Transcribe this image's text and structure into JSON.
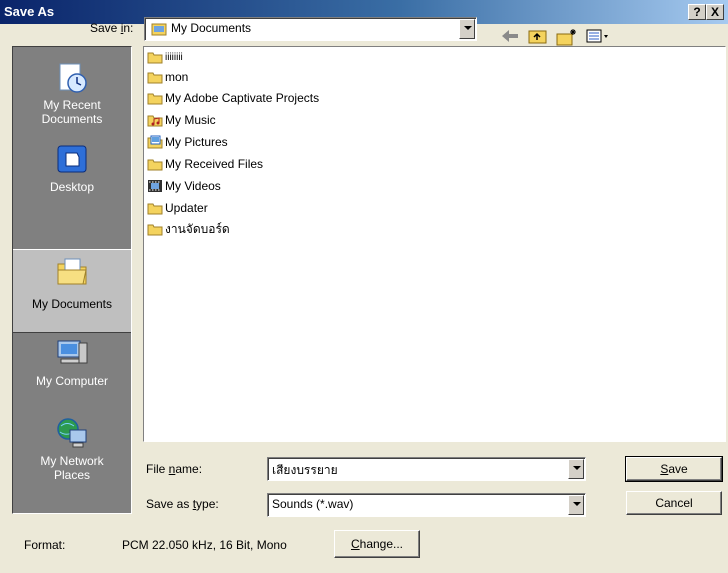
{
  "window": {
    "title": "Save As",
    "help_label": "?",
    "close_label": "X"
  },
  "toolbar": {
    "save_in_label": "Save in:",
    "save_in_value": "My Documents",
    "icons": [
      "back-arrow-icon",
      "up-folder-icon",
      "new-folder-icon",
      "view-menu-icon"
    ]
  },
  "places": [
    {
      "label": "My Recent\nDocuments",
      "icon": "recent-documents-icon"
    },
    {
      "label": "Desktop",
      "icon": "desktop-icon"
    },
    {
      "label": "My Documents",
      "icon": "my-documents-icon"
    },
    {
      "label": "My Computer",
      "icon": "my-computer-icon"
    },
    {
      "label": "My Network\nPlaces",
      "icon": "network-places-icon"
    }
  ],
  "files": [
    {
      "name": "iiiiiiii",
      "icon": "folder"
    },
    {
      "name": "mon",
      "icon": "folder"
    },
    {
      "name": "My Adobe Captivate Projects",
      "icon": "folder"
    },
    {
      "name": "My Music",
      "icon": "music-folder"
    },
    {
      "name": "My Pictures",
      "icon": "pictures-folder"
    },
    {
      "name": "My Received Files",
      "icon": "folder"
    },
    {
      "name": "My Videos",
      "icon": "videos-folder"
    },
    {
      "name": "Updater",
      "icon": "folder"
    },
    {
      "name": "งานจัดบอร์ด",
      "icon": "folder"
    }
  ],
  "form": {
    "file_name_label": "File name:",
    "file_name_value": "เสียงบรรยาย",
    "save_type_label": "Save as type:",
    "save_type_value": "Sounds (*.wav)",
    "save_button": "Save",
    "cancel_button": "Cancel"
  },
  "format": {
    "label": "Format:",
    "value": "PCM 22.050 kHz, 16 Bit, Mono",
    "change_button": "Change..."
  },
  "colors": {
    "titlebar": "#0A246A",
    "dialog_bg": "#ECE9D8",
    "places_bg": "#808080",
    "folder": "#F4D35E"
  }
}
